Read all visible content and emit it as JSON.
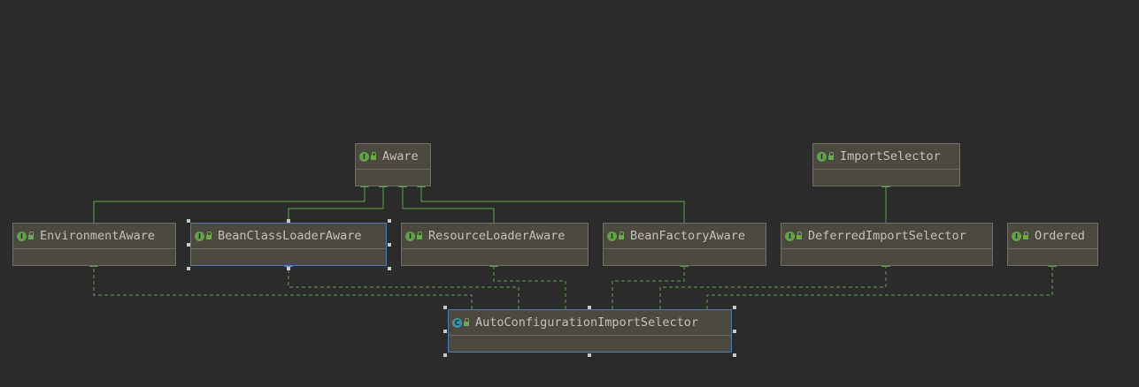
{
  "colors": {
    "background": "#2b2b2b",
    "node_fill": "#4b4940",
    "node_border": "#6f6e66",
    "selected_border": "#4d7aaa",
    "edge": "#5fa04e",
    "interface_badge": "#62a14a",
    "class_badge": "#3f93a8"
  },
  "nodes": {
    "aware": {
      "label": "Aware",
      "badge": "I",
      "kind": "interface"
    },
    "import_selector": {
      "label": "ImportSelector",
      "badge": "I",
      "kind": "interface"
    },
    "environment_aware": {
      "label": "EnvironmentAware",
      "badge": "I",
      "kind": "interface"
    },
    "bean_class_loader_aware": {
      "label": "BeanClassLoaderAware",
      "badge": "I",
      "kind": "interface",
      "selected": true
    },
    "resource_loader_aware": {
      "label": "ResourceLoaderAware",
      "badge": "I",
      "kind": "interface"
    },
    "bean_factory_aware": {
      "label": "BeanFactoryAware",
      "badge": "I",
      "kind": "interface"
    },
    "deferred_import_selector": {
      "label": "DeferredImportSelector",
      "badge": "I",
      "kind": "interface"
    },
    "ordered": {
      "label": "Ordered",
      "badge": "I",
      "kind": "interface"
    },
    "auto_configuration_import_selector": {
      "label": "AutoConfigurationImportSelector",
      "badge": "C",
      "kind": "class",
      "selected": true
    }
  },
  "edges": [
    {
      "from": "environment_aware",
      "to": "aware",
      "type": "extends"
    },
    {
      "from": "bean_class_loader_aware",
      "to": "aware",
      "type": "extends"
    },
    {
      "from": "resource_loader_aware",
      "to": "aware",
      "type": "extends"
    },
    {
      "from": "bean_factory_aware",
      "to": "aware",
      "type": "extends"
    },
    {
      "from": "deferred_import_selector",
      "to": "import_selector",
      "type": "extends"
    },
    {
      "from": "auto_configuration_import_selector",
      "to": "environment_aware",
      "type": "implements"
    },
    {
      "from": "auto_configuration_import_selector",
      "to": "bean_class_loader_aware",
      "type": "implements"
    },
    {
      "from": "auto_configuration_import_selector",
      "to": "resource_loader_aware",
      "type": "implements"
    },
    {
      "from": "auto_configuration_import_selector",
      "to": "bean_factory_aware",
      "type": "implements"
    },
    {
      "from": "auto_configuration_import_selector",
      "to": "deferred_import_selector",
      "type": "implements"
    },
    {
      "from": "auto_configuration_import_selector",
      "to": "ordered",
      "type": "implements"
    }
  ]
}
